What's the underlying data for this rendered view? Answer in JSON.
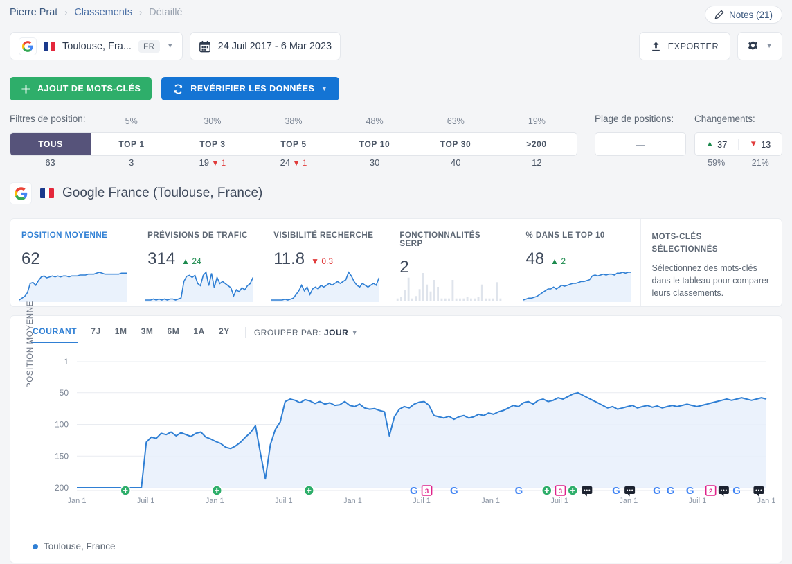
{
  "breadcrumb": {
    "root": "Pierre Prat",
    "section": "Classements",
    "current": "Détaillé",
    "sep": "›"
  },
  "header": {
    "notes_label": "Notes (21)",
    "notes_icon": "edit-icon",
    "export_label": "EXPORTER",
    "export_icon": "upload-icon",
    "gear_icon": "gear-icon",
    "chevron_icon": "chevron-down-icon"
  },
  "selector": {
    "engine_icon": "google-icon",
    "flag_icon": "france-flag-icon",
    "location": "Toulouse, Fra...",
    "lang_badge": "FR",
    "date_icon": "calendar-icon",
    "date_range": "24 Juil 2017 - 6 Mar 2023"
  },
  "actions": {
    "add_keywords": "AJOUT DE MOTS-CLÉS",
    "add_icon": "plus-icon",
    "recheck": "REVÉRIFIER LES DONNÉES",
    "recheck_icon": "refresh-icon"
  },
  "filters": {
    "label": "Filtres de position:",
    "tabs": [
      {
        "label": "TOUS",
        "pct": "",
        "count": "63",
        "delta": "",
        "dir": ""
      },
      {
        "label": "TOP 1",
        "pct": "5%",
        "count": "3",
        "delta": "",
        "dir": ""
      },
      {
        "label": "TOP 3",
        "pct": "30%",
        "count": "19",
        "delta": "1",
        "dir": "down"
      },
      {
        "label": "TOP 5",
        "pct": "38%",
        "count": "24",
        "delta": "1",
        "dir": "down"
      },
      {
        "label": "TOP 10",
        "pct": "48%",
        "count": "30",
        "delta": "",
        "dir": ""
      },
      {
        "label": "TOP 30",
        "pct": "63%",
        "count": "40",
        "delta": "",
        "dir": ""
      },
      {
        "label": ">200",
        "pct": "19%",
        "count": "12",
        "delta": "",
        "dir": ""
      }
    ],
    "selected": "TOUS",
    "range_label": "Plage de positions:",
    "range_dash": "—",
    "changes_label": "Changements:",
    "changes_up": "37",
    "changes_down": "13",
    "changes_up_pct": "59%",
    "changes_down_pct": "21%"
  },
  "engine": {
    "icon": "google-icon",
    "flag": "france-flag-icon",
    "name": "Google France (Toulouse, France)"
  },
  "cards": [
    {
      "title": "POSITION MOYENNE",
      "value": "62",
      "delta": "",
      "dir": "",
      "active": true
    },
    {
      "title": "PRÉVISIONS DE TRAFIC",
      "value": "314",
      "delta": "24",
      "dir": "up",
      "active": false
    },
    {
      "title": "VISIBILITÉ RECHERCHE",
      "value": "11.8",
      "delta": "0.3",
      "dir": "down",
      "active": false
    },
    {
      "title": "FONCTIONNALITÉS SERP",
      "value": "2",
      "delta": "",
      "dir": "",
      "active": false
    },
    {
      "title": "% DANS LE TOP 10",
      "value": "48",
      "delta": "2",
      "dir": "up",
      "active": false
    }
  ],
  "keywords_card": {
    "title_line1": "MOTS-CLÉS",
    "title_line2": "SÉLECTIONNÉS",
    "description": "Sélectionnez des mots-clés dans le tableau pour comparer leurs classements."
  },
  "chart_controls": {
    "ranges": [
      "COURANT",
      "7J",
      "1M",
      "3M",
      "6M",
      "1A",
      "2Y"
    ],
    "active_range": "COURANT",
    "group_label": "GROUPER PAR:",
    "group_value": "JOUR",
    "group_chevron": "chevron-down-icon"
  },
  "legend": {
    "series_label": "Toulouse, France",
    "color": "#2f7fd4"
  },
  "chart_data": {
    "type": "line",
    "title": "",
    "xlabel": "",
    "ylabel": "POSITION MOYENNE",
    "ylim": [
      1,
      200
    ],
    "y_inverted": true,
    "yticks": [
      1,
      50,
      100,
      150,
      200
    ],
    "grid": true,
    "legend_position": "bottom-left",
    "line_color": "#2f7fd4",
    "fill_color": "#e8f0fb",
    "xticks": [
      "Jan 1",
      "Juil 1",
      "Jan 1",
      "Juil 1",
      "Jan 1",
      "Juil 1",
      "Jan 1",
      "Juil 1",
      "Jan 1",
      "Juil 1",
      "Jan 1"
    ],
    "series": [
      {
        "name": "Toulouse, France",
        "values": [
          200,
          200,
          200,
          200,
          200,
          200,
          200,
          200,
          200,
          200,
          200,
          200,
          200,
          200,
          128,
          120,
          122,
          114,
          116,
          112,
          118,
          113,
          116,
          119,
          114,
          112,
          120,
          123,
          127,
          130,
          136,
          138,
          134,
          128,
          120,
          113,
          102,
          145,
          186,
          132,
          108,
          96,
          64,
          60,
          62,
          66,
          61,
          63,
          67,
          64,
          68,
          66,
          70,
          69,
          64,
          70,
          72,
          68,
          74,
          76,
          75,
          78,
          80,
          118,
          88,
          76,
          72,
          74,
          68,
          65,
          64,
          70,
          86,
          88,
          90,
          87,
          92,
          88,
          86,
          90,
          88,
          84,
          86,
          82,
          84,
          80,
          78,
          74,
          70,
          72,
          66,
          64,
          68,
          62,
          60,
          64,
          62,
          58,
          60,
          56,
          52,
          50,
          54,
          58,
          62,
          66,
          70,
          74,
          72,
          76,
          74,
          72,
          70,
          74,
          72,
          70,
          73,
          71,
          74,
          72,
          70,
          72,
          70,
          68,
          70,
          72,
          70,
          68,
          66,
          64,
          62,
          60,
          62,
          60,
          58,
          60,
          62,
          60,
          58,
          60
        ]
      }
    ],
    "markers": [
      {
        "x_pct": 7.5,
        "type": "add-keyword-marker"
      },
      {
        "x_pct": 21.6,
        "type": "add-keyword-marker"
      },
      {
        "x_pct": 35.8,
        "type": "add-keyword-marker"
      },
      {
        "x_pct": 52.0,
        "type": "google-update-marker"
      },
      {
        "x_pct": 54.0,
        "type": "serp-badge-marker",
        "count": "3"
      },
      {
        "x_pct": 58.2,
        "type": "google-update-marker"
      },
      {
        "x_pct": 68.2,
        "type": "google-update-marker"
      },
      {
        "x_pct": 72.5,
        "type": "add-keyword-marker"
      },
      {
        "x_pct": 74.6,
        "type": "serp-badge-marker",
        "count": "3"
      },
      {
        "x_pct": 76.5,
        "type": "add-keyword-marker"
      },
      {
        "x_pct": 78.7,
        "type": "note-marker"
      },
      {
        "x_pct": 83.2,
        "type": "google-update-marker"
      },
      {
        "x_pct": 85.3,
        "type": "note-marker"
      },
      {
        "x_pct": 89.5,
        "type": "google-update-marker"
      },
      {
        "x_pct": 91.6,
        "type": "google-update-marker"
      },
      {
        "x_pct": 94.6,
        "type": "google-update-marker"
      },
      {
        "x_pct": 97.8,
        "type": "serp-badge-marker",
        "count": "2"
      },
      {
        "x_pct": 99.8,
        "type": "note-marker"
      },
      {
        "x_pct": 101.8,
        "type": "google-update-marker"
      },
      {
        "x_pct": 105.2,
        "type": "note-marker"
      }
    ]
  },
  "sparklines": {
    "position_moyenne": [
      38,
      36,
      34,
      30,
      20,
      19,
      22,
      17,
      13,
      12,
      14,
      13,
      12,
      13,
      12,
      13,
      12,
      12,
      13,
      12,
      12,
      12,
      11,
      11,
      11,
      10,
      10,
      10,
      9,
      8,
      9,
      10,
      10,
      10,
      10,
      10,
      10,
      9,
      9,
      9
    ],
    "previsions_trafic": [
      36,
      36,
      36,
      35,
      36,
      35,
      36,
      35,
      36,
      35,
      35,
      36,
      35,
      34,
      18,
      13,
      12,
      14,
      12,
      20,
      22,
      12,
      9,
      22,
      10,
      24,
      14,
      20,
      18,
      20,
      22,
      24,
      32,
      26,
      28,
      24,
      26,
      22,
      20,
      14
    ],
    "visibilite_recherche": [
      36,
      36,
      36,
      36,
      36,
      35,
      36,
      35,
      34,
      30,
      26,
      20,
      26,
      22,
      30,
      24,
      22,
      24,
      20,
      22,
      20,
      18,
      20,
      18,
      16,
      18,
      16,
      14,
      6,
      10,
      16,
      20,
      22,
      18,
      20,
      22,
      20,
      18,
      20,
      12
    ],
    "pct_top10": [
      34,
      33,
      32,
      32,
      31,
      30,
      28,
      26,
      24,
      22,
      22,
      20,
      22,
      20,
      18,
      19,
      18,
      17,
      16,
      16,
      15,
      14,
      14,
      13,
      12,
      8,
      7,
      8,
      7,
      6,
      7,
      6,
      6,
      7,
      5,
      5,
      4,
      5,
      4,
      4
    ],
    "serp_features": [
      2,
      3,
      9,
      20,
      2,
      4,
      10,
      24,
      14,
      8,
      18,
      12,
      2,
      2,
      2,
      18,
      2,
      2,
      2,
      3,
      2,
      2,
      3,
      14,
      2,
      2,
      2,
      16,
      2
    ]
  }
}
